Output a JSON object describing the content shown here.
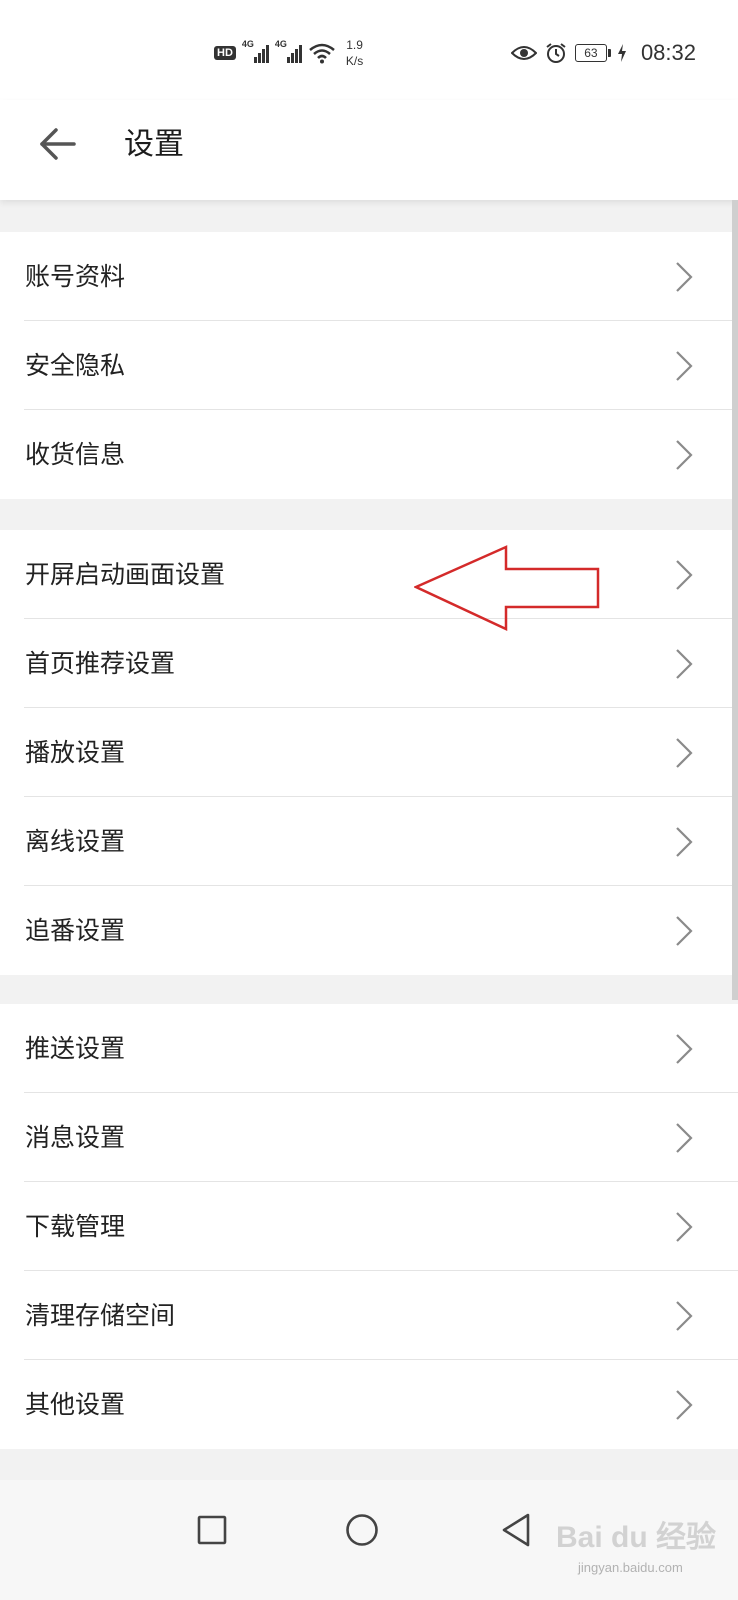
{
  "status_bar": {
    "hd_badge": "HD",
    "sim1_network": "4G",
    "sim2_network": "4G",
    "speed_value": "1.9",
    "speed_unit": "K/s",
    "battery_level": "63",
    "time": "08:32"
  },
  "header": {
    "title": "设置"
  },
  "groups": [
    {
      "items": [
        {
          "label": "账号资料"
        },
        {
          "label": "安全隐私"
        },
        {
          "label": "收货信息"
        }
      ]
    },
    {
      "items": [
        {
          "label": "开屏启动画面设置"
        },
        {
          "label": "首页推荐设置"
        },
        {
          "label": "播放设置"
        },
        {
          "label": "离线设置"
        },
        {
          "label": "追番设置"
        }
      ]
    },
    {
      "items": [
        {
          "label": "推送设置"
        },
        {
          "label": "消息设置"
        },
        {
          "label": "下载管理"
        },
        {
          "label": "清理存储空间"
        },
        {
          "label": "其他设置"
        }
      ]
    }
  ],
  "annotation": {
    "color": "#d42a2a",
    "target_label": "开屏启动画面设置"
  },
  "watermark": {
    "text": "Bai du 经验",
    "sub": "jingyan.baidu.com"
  },
  "colors": {
    "background": "#f2f2f2",
    "surface": "#ffffff",
    "divider": "#e4e4e4",
    "text": "#222222",
    "chevron": "#8a8a8a"
  }
}
